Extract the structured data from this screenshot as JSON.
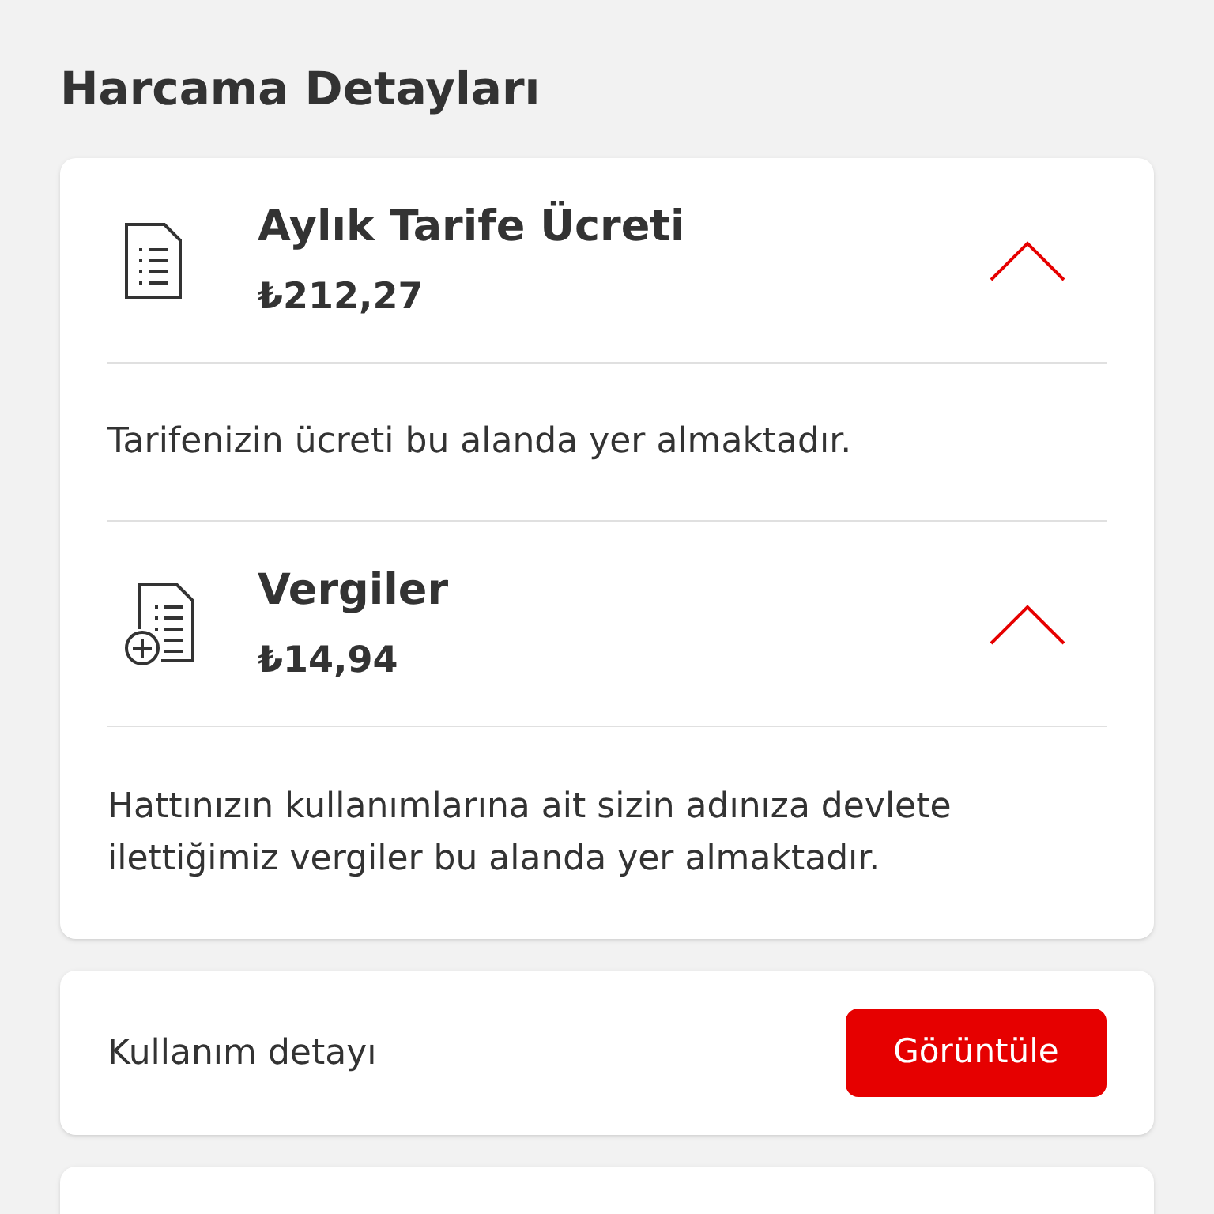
{
  "title": "Harcama Detayları",
  "sections": [
    {
      "kind": "invoice",
      "title": "Aylık Tarife Ücreti",
      "amount": "₺212,27",
      "expanded": true,
      "description": "Tarifenizin ücreti bu alanda yer almaktadır."
    },
    {
      "kind": "tax",
      "title": "Vergiler",
      "amount": "₺14,94",
      "expanded": true,
      "description": "Hattınızın kullanımlarına ait sizin adınıza devlete ilettiğimiz vergiler bu alanda yer almaktadır."
    }
  ],
  "usage": {
    "label": "Kullanım detayı",
    "button": "Görüntüle"
  }
}
